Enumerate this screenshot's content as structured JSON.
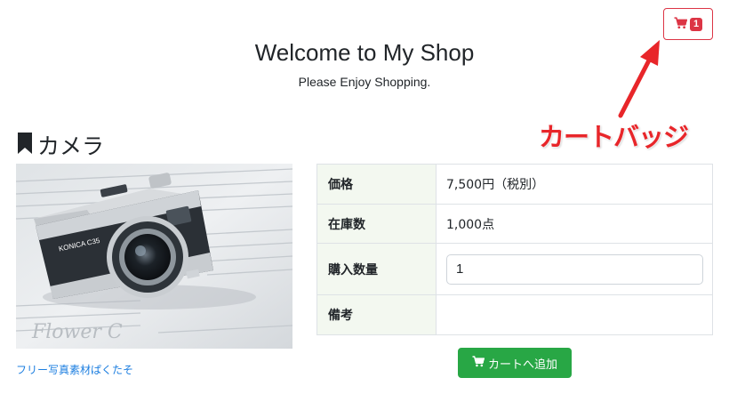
{
  "header": {
    "title": "Welcome to My Shop",
    "subtitle": "Please Enjoy Shopping.",
    "cart": {
      "icon": "cart-icon",
      "badge_count": "1",
      "accent_color": "#dc3545"
    }
  },
  "annotation": {
    "label": "カートバッジ",
    "color": "#e8262a"
  },
  "product": {
    "icon": "bookmark-icon",
    "name": "カメラ",
    "image_credit": "フリー写真素材ぱくたそ",
    "specs": {
      "price_label": "価格",
      "price_value": "7,500円（税別）",
      "stock_label": "在庫数",
      "stock_value": "1,000点",
      "quantity_label": "購入数量",
      "quantity_value": "1",
      "notes_label": "備考",
      "notes_value": ""
    }
  },
  "actions": {
    "add_to_cart_label": "カートへ追加",
    "add_to_cart_icon": "cart-icon",
    "button_color": "#28a745"
  }
}
